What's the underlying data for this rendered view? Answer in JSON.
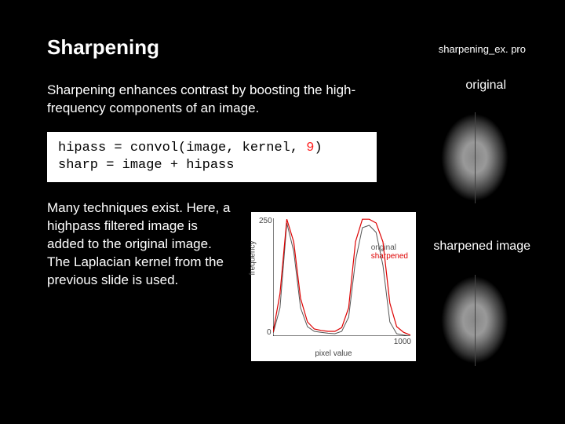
{
  "title": "Sharpening",
  "filename": "sharpening_ex. pro",
  "intro": "Sharpening enhances contrast by boosting the high-frequency components of an image.",
  "code_line1_a": "hipass = convol(image, kernel, ",
  "code_line1_num": "9",
  "code_line1_b": ")",
  "code_line2": "sharp = image + hipass",
  "para2": "Many techniques exist. Here, a highpass filtered image is added to the original image. The Laplacian kernel from the previous slide is used.",
  "label_original": "original",
  "label_sharpened": "sharpened image",
  "chart_data": {
    "type": "line",
    "title": "",
    "xlabel": "pixel value",
    "ylabel": "frequency",
    "xlim": [
      0,
      1000
    ],
    "ylim": [
      0,
      250
    ],
    "x": [
      0,
      50,
      100,
      150,
      200,
      250,
      300,
      350,
      400,
      450,
      500,
      550,
      600,
      650,
      700,
      750,
      800,
      850,
      900,
      950,
      1000
    ],
    "series": [
      {
        "name": "original",
        "values": [
          5,
          60,
          240,
          180,
          60,
          20,
          10,
          8,
          6,
          5,
          10,
          40,
          160,
          230,
          235,
          220,
          150,
          30,
          5,
          2,
          0
        ]
      },
      {
        "name": "sharpened",
        "values": [
          8,
          90,
          248,
          200,
          80,
          30,
          15,
          12,
          10,
          10,
          18,
          60,
          200,
          248,
          248,
          240,
          200,
          70,
          20,
          8,
          2
        ]
      }
    ],
    "legend": [
      "original",
      "sharpened"
    ],
    "ytick_top": "250",
    "ytick_bot": "0",
    "xtick_r": "1000"
  }
}
